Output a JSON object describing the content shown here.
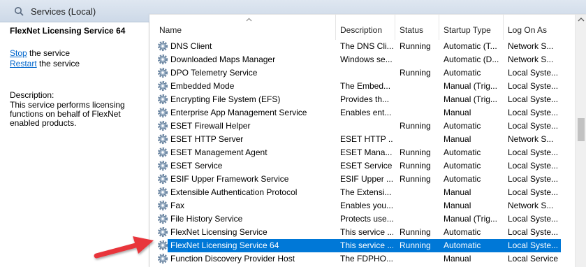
{
  "window": {
    "title": "Services (Local)"
  },
  "left_panel": {
    "service_title": "FlexNet Licensing Service 64",
    "stop_link": "Stop",
    "stop_suffix": " the service",
    "restart_link": "Restart",
    "restart_suffix": " the service",
    "description_label": "Description:",
    "description_text": "This service performs licensing functions on behalf of FlexNet enabled products."
  },
  "table": {
    "columns": [
      "Name",
      "Description",
      "Status",
      "Startup Type",
      "Log On As"
    ],
    "rows": [
      {
        "name": "DNS Client",
        "description": "The DNS Cli...",
        "status": "Running",
        "startup": "Automatic (T...",
        "logon": "Network S..."
      },
      {
        "name": "Downloaded Maps Manager",
        "description": "Windows se...",
        "status": "",
        "startup": "Automatic (D...",
        "logon": "Network S..."
      },
      {
        "name": "DPO Telemetry Service",
        "description": "",
        "status": "Running",
        "startup": "Automatic",
        "logon": "Local Syste..."
      },
      {
        "name": "Embedded Mode",
        "description": "The Embed...",
        "status": "",
        "startup": "Manual (Trig...",
        "logon": "Local Syste..."
      },
      {
        "name": "Encrypting File System (EFS)",
        "description": "Provides th...",
        "status": "",
        "startup": "Manual (Trig...",
        "logon": "Local Syste..."
      },
      {
        "name": "Enterprise App Management Service",
        "description": "Enables ent...",
        "status": "",
        "startup": "Manual",
        "logon": "Local Syste..."
      },
      {
        "name": "ESET Firewall Helper",
        "description": "",
        "status": "Running",
        "startup": "Automatic",
        "logon": "Local Syste..."
      },
      {
        "name": "ESET HTTP Server",
        "description": "ESET HTTP ...",
        "status": "",
        "startup": "Manual",
        "logon": "Network S..."
      },
      {
        "name": "ESET Management Agent",
        "description": "ESET Mana...",
        "status": "Running",
        "startup": "Automatic",
        "logon": "Local Syste..."
      },
      {
        "name": "ESET Service",
        "description": "ESET Service",
        "status": "Running",
        "startup": "Automatic",
        "logon": "Local Syste..."
      },
      {
        "name": "ESIF Upper Framework Service",
        "description": "ESIF Upper ...",
        "status": "Running",
        "startup": "Automatic",
        "logon": "Local Syste..."
      },
      {
        "name": "Extensible Authentication Protocol",
        "description": "The Extensi...",
        "status": "",
        "startup": "Manual",
        "logon": "Local Syste..."
      },
      {
        "name": "Fax",
        "description": "Enables you...",
        "status": "",
        "startup": "Manual",
        "logon": "Network S..."
      },
      {
        "name": "File History Service",
        "description": "Protects use...",
        "status": "",
        "startup": "Manual (Trig...",
        "logon": "Local Syste..."
      },
      {
        "name": "FlexNet Licensing Service",
        "description": "This service ...",
        "status": "Running",
        "startup": "Automatic",
        "logon": "Local Syste..."
      },
      {
        "name": "FlexNet Licensing Service 64",
        "description": "This service ...",
        "status": "Running",
        "startup": "Automatic",
        "logon": "Local Syste...",
        "selected": true
      },
      {
        "name": "Function Discovery Provider Host",
        "description": "The FDPHO...",
        "status": "",
        "startup": "Manual",
        "logon": "Local Service"
      }
    ]
  },
  "colors": {
    "selection": "#0078d7",
    "link": "#0066cc",
    "annotation_arrow": "#e8353b"
  },
  "icons": {
    "title": "services-magnifier-icon",
    "row": "gear-icon",
    "sort": "sort-ascending-icon",
    "annotation": "red-arrow-icon"
  }
}
